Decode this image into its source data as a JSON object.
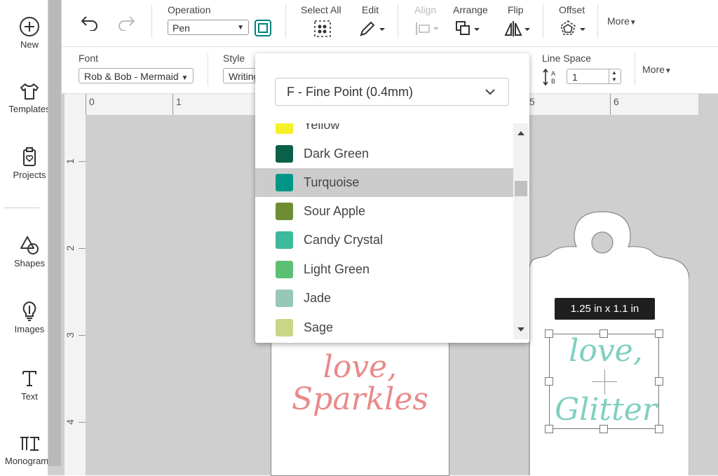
{
  "sidebar": {
    "items": [
      {
        "label": "New",
        "icon": "plus-circle-icon"
      },
      {
        "label": "Templates",
        "icon": "shirt-icon"
      },
      {
        "label": "Projects",
        "icon": "clipboard-heart-icon"
      },
      {
        "label": "Shapes",
        "icon": "shapes-icon"
      },
      {
        "label": "Images",
        "icon": "lightbulb-icon"
      },
      {
        "label": "Text",
        "icon": "text-icon"
      },
      {
        "label": "Monogram",
        "icon": "monogram-icon"
      }
    ]
  },
  "toolbar": {
    "operation_label": "Operation",
    "operation_value": "Pen",
    "select_all_label": "Select All",
    "edit_label": "Edit",
    "align_label": "Align",
    "arrange_label": "Arrange",
    "flip_label": "Flip",
    "offset_label": "Offset",
    "more_label": "More",
    "pen_color": "#00827a"
  },
  "textbar": {
    "font_label": "Font",
    "font_value": "Rob & Bob - Mermaid",
    "style_label": "Style",
    "style_value": "Writing",
    "line_space_label": "Line Space",
    "line_space_value": "1",
    "more_label": "More"
  },
  "rulers": {
    "top": [
      "0",
      "1",
      "5",
      "6"
    ],
    "left": [
      "1",
      "2",
      "3",
      "4"
    ]
  },
  "dropdown": {
    "pen_type": "F - Fine Point (0.4mm)",
    "colors": [
      {
        "name": "Yellow",
        "hex": "#f5f027",
        "selected": false
      },
      {
        "name": "Dark Green",
        "hex": "#0a6048",
        "selected": false
      },
      {
        "name": "Turquoise",
        "hex": "#009687",
        "selected": true
      },
      {
        "name": "Sour Apple",
        "hex": "#6e8c31",
        "selected": false
      },
      {
        "name": "Candy Crystal",
        "hex": "#3db99c",
        "selected": false
      },
      {
        "name": "Light Green",
        "hex": "#5dbf73",
        "selected": false
      },
      {
        "name": "Jade",
        "hex": "#97c7b5",
        "selected": false
      },
      {
        "name": "Sage",
        "hex": "#c9d686",
        "selected": false
      }
    ]
  },
  "canvas": {
    "left_tag_text_1": "love,",
    "left_tag_text_2": "Sparkles",
    "left_tag_color": "#e88a8a",
    "right_tag_text_1": "love,",
    "right_tag_text_2": "Glitter",
    "right_tag_color": "#7fd0c0",
    "dimensions": "1.25  in x 1.1  in"
  }
}
